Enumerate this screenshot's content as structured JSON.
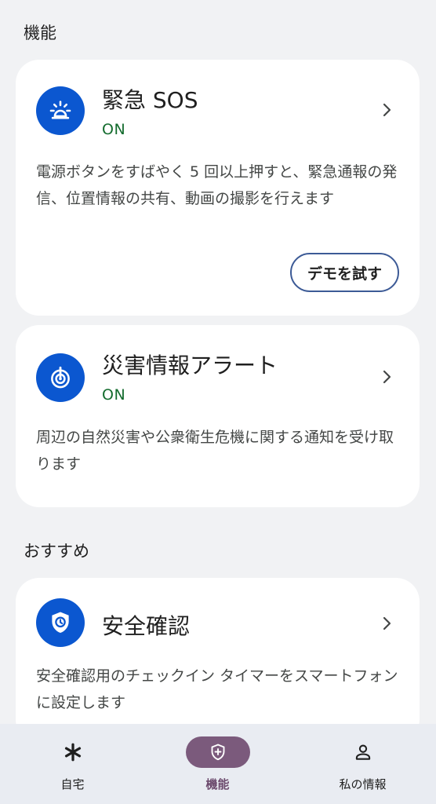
{
  "sections": {
    "features_title": "機能",
    "recommended_title": "おすすめ"
  },
  "cards": {
    "sos": {
      "title": "緊急 SOS",
      "status": "ON",
      "description": "電源ボタンをすばやく 5 回以上押すと、緊急通報の発信、位置情報の共有、動画の撮影を行えます",
      "button": "デモを試す",
      "icon": "siren-icon"
    },
    "alerts": {
      "title": "災害情報アラート",
      "status": "ON",
      "description": "周辺の自然災害や公衆衛生危機に関する通知を受け取ります",
      "icon": "alert-broadcast-icon"
    },
    "safety_check": {
      "title": "安全確認",
      "description": "安全確認用のチェックイン タイマーをスマートフォンに設定します",
      "icon": "shield-clock-icon"
    }
  },
  "nav": {
    "items": [
      {
        "label": "自宅",
        "icon": "asterisk-icon"
      },
      {
        "label": "機能",
        "icon": "shield-plus-icon",
        "active": true
      },
      {
        "label": "私の情報",
        "icon": "person-icon"
      }
    ]
  },
  "colors": {
    "accent": "#0b57d0",
    "status_on": "#146c2e",
    "nav_active": "#7b5a7c"
  }
}
